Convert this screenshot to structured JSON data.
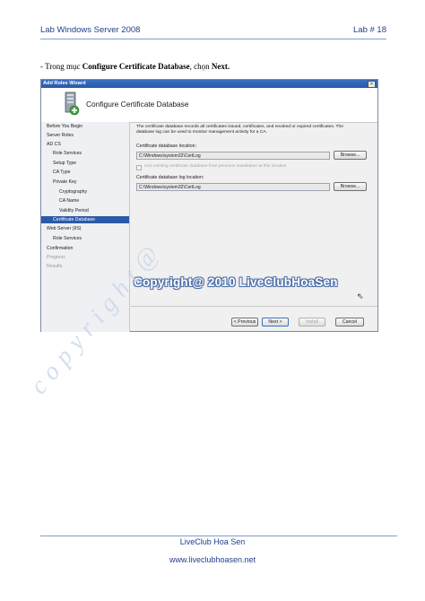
{
  "header": {
    "left": "Lab Windows Server 2008",
    "right": "Lab # 18"
  },
  "instruction": {
    "prefix": "- Trong mục ",
    "bold1": "Configure Certificate Database",
    "middle": ", chọn ",
    "bold2": "Next."
  },
  "window": {
    "title": "Add Roles Wizard",
    "close": "×",
    "page_title": "Configure Certificate Database",
    "nav": [
      {
        "label": "Before You Begin",
        "state": "normal"
      },
      {
        "label": "Server Roles",
        "state": "normal"
      },
      {
        "label": "AD CS",
        "state": "normal"
      },
      {
        "label": "Role Services",
        "state": "normal"
      },
      {
        "label": "Setup Type",
        "state": "normal"
      },
      {
        "label": "CA Type",
        "state": "normal"
      },
      {
        "label": "Private Key",
        "state": "normal"
      },
      {
        "label": "Cryptography",
        "state": "normal"
      },
      {
        "label": "CA Name",
        "state": "normal"
      },
      {
        "label": "Validity Period",
        "state": "normal"
      },
      {
        "label": "Certificate Database",
        "state": "selected"
      },
      {
        "label": "Web Server (IIS)",
        "state": "normal"
      },
      {
        "label": "Role Services",
        "state": "normal"
      },
      {
        "label": "Confirmation",
        "state": "normal"
      },
      {
        "label": "Progress",
        "state": "disabled"
      },
      {
        "label": "Results",
        "state": "disabled"
      }
    ],
    "description": "The certificate database records all certificates issued, certificates, and revoked or expired certificates. The database log can be used to monitor management activity for a CA.",
    "db_label": "Certificate database location:",
    "db_value": "C:\\Windows\\system32\\CertLog",
    "browse1": "Browse...",
    "checkbox_label": "Use existing certificate database from previous installation at this location",
    "log_label": "Certificate database log location:",
    "log_value": "C:\\Windows\\system32\\CertLog",
    "browse2": "Browse...",
    "prev": "< Previous",
    "next": "Next >",
    "install": "Install",
    "cancel": "Cancel"
  },
  "watermark": "Copyright@ 2010 LiveClubHoaSen",
  "diagonal_watermark": "copyright@",
  "footer": {
    "line1": "LiveClub Hoa Sen",
    "line2": "www.liveclubhoasen.net"
  }
}
